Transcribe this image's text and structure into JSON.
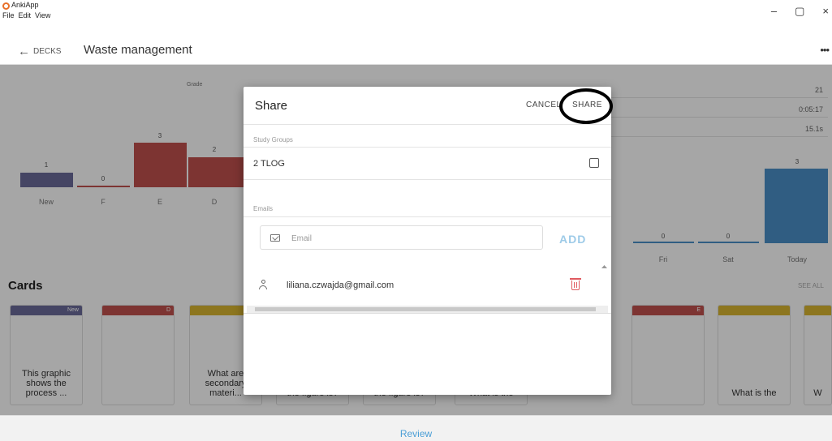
{
  "window": {
    "app_title": "AnkiApp",
    "menu": [
      "File",
      "Edit",
      "View"
    ],
    "controls": [
      "–",
      "▢",
      "×"
    ]
  },
  "header": {
    "back_label": "DECKS",
    "deck_title": "Waste management",
    "more": "•••"
  },
  "stats": {
    "grade_label": "Grade",
    "grade_bars": [
      {
        "label": "New",
        "value": 1,
        "color": "#6b6b9a"
      },
      {
        "label": "F",
        "value": 0,
        "color": "#c0504d"
      },
      {
        "label": "E",
        "value": 3,
        "color": "#c0504d"
      },
      {
        "label": "D",
        "value": 2,
        "color": "#c0504d"
      }
    ],
    "day_bars": [
      {
        "label": "Fri",
        "value": 0
      },
      {
        "label": "Sat",
        "value": 0
      },
      {
        "label": "Today",
        "value": 3
      }
    ],
    "summary_values": [
      "21",
      "0:05:17",
      "15.1s"
    ]
  },
  "cards_section": {
    "heading": "Cards",
    "see_all": "SEE ALL",
    "cards": [
      {
        "badge": "New",
        "color": "#6b6b9a",
        "text": "This graphic shows the process ..."
      },
      {
        "badge": "D",
        "color": "#c0504d",
        "text": ""
      },
      {
        "badge": "",
        "color": "#d9b630",
        "text": "What are secondary materi..."
      },
      {
        "badge": "",
        "color": "#d9b630",
        "text": "the figure is?"
      },
      {
        "badge": "",
        "color": "#d9b630",
        "text": "the figure is?"
      },
      {
        "badge": "",
        "color": "#d9b630",
        "text": "What is the"
      },
      {
        "badge": "E",
        "color": "#c0504d",
        "text": ""
      },
      {
        "badge": "",
        "color": "#d9b630",
        "text": "What is the"
      },
      {
        "badge": "",
        "color": "#d9b630",
        "text": "W"
      }
    ]
  },
  "review_label": "Review",
  "share_modal": {
    "title": "Share",
    "cancel_label": "CANCEL",
    "share_label": "SHARE",
    "study_groups_label": "Study Groups",
    "group_name": "2 TLOG",
    "emails_label": "Emails",
    "email_placeholder": "Email",
    "add_label": "ADD",
    "members": [
      "liliana.czwajda@gmail.com"
    ]
  },
  "colors": {
    "accent": "#4a9ed6",
    "add_disabled": "#9ecbe8",
    "delete": "#e05a60",
    "grade_new": "#6b6b9a",
    "grade_red": "#c0504d",
    "day_bar": "#4a90c8"
  }
}
